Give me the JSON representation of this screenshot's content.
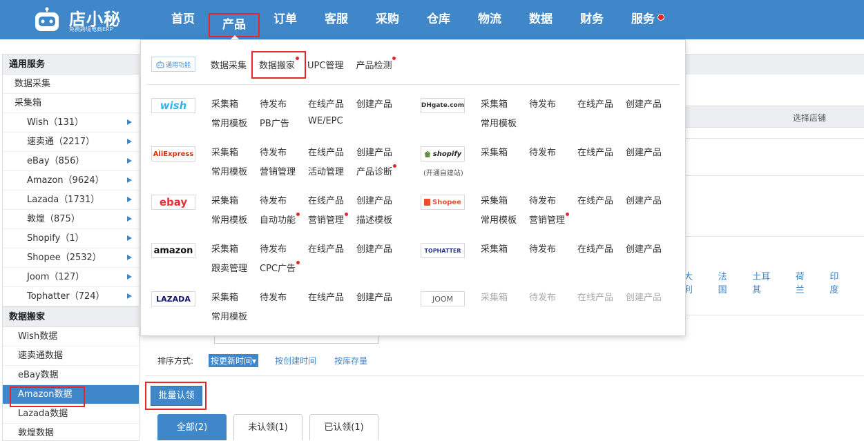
{
  "brand": {
    "title": "店小秘",
    "subtitle": "免费跨境电商ERP"
  },
  "topnav": [
    {
      "label": "首页",
      "active": false,
      "dot": false
    },
    {
      "label": "产品",
      "active": true,
      "dot": false
    },
    {
      "label": "订单",
      "active": false,
      "dot": false
    },
    {
      "label": "客服",
      "active": false,
      "dot": false
    },
    {
      "label": "采购",
      "active": false,
      "dot": false
    },
    {
      "label": "仓库",
      "active": false,
      "dot": false
    },
    {
      "label": "物流",
      "active": false,
      "dot": false
    },
    {
      "label": "数据",
      "active": false,
      "dot": false
    },
    {
      "label": "财务",
      "active": false,
      "dot": false
    },
    {
      "label": "服务",
      "active": false,
      "dot": true
    }
  ],
  "sidebar": {
    "section1": "通用服务",
    "data_collect": "数据采集",
    "collect_box": "采集箱",
    "platforms": [
      {
        "name": "Wish",
        "count": "（131）"
      },
      {
        "name": "速卖通",
        "count": "（2217）"
      },
      {
        "name": "eBay",
        "count": "（856）"
      },
      {
        "name": "Amazon",
        "count": "（9624）"
      },
      {
        "name": "Lazada",
        "count": "（1731）"
      },
      {
        "name": "敦煌",
        "count": "（875）"
      },
      {
        "name": "Shopify",
        "count": "（1）"
      },
      {
        "name": "Shopee",
        "count": "（2532）"
      },
      {
        "name": "Joom",
        "count": "（127）"
      },
      {
        "name": "Tophatter",
        "count": "（724）"
      }
    ],
    "section2": "数据搬家",
    "move_items": [
      "Wish数据",
      "速卖通数据",
      "eBay数据",
      "Amazon数据",
      "Lazada数据",
      "敦煌数据"
    ],
    "active_move_item": "Amazon数据"
  },
  "main": {
    "choose_shop": "选择店铺",
    "countries": [
      "大利",
      "法国",
      "土耳其",
      "荷兰",
      "印度"
    ],
    "sort_label": "排序方式:",
    "sort_active": "按更新时间▾",
    "sort_options": [
      "按创建时间",
      "按库存量"
    ],
    "bulk_claim": "批量认领",
    "tabs": [
      "全部(2)",
      "未认领(1)",
      "已认领(1)"
    ]
  },
  "mega": {
    "general_badge": "通用功能",
    "general_links": [
      "数据采集",
      "数据搬家",
      "UPC管理",
      "产品检测"
    ],
    "platforms": {
      "wish": {
        "logo": "wish",
        "links": [
          "采集箱",
          "待发布",
          "在线产品",
          "创建产品",
          "常用模板",
          "PB广告",
          "WE/EPC"
        ]
      },
      "dhgate": {
        "logo": "DHgate.com",
        "links": [
          "采集箱",
          "待发布",
          "在线产品",
          "创建产品",
          "常用模板"
        ]
      },
      "aliexpress": {
        "logo": "AliExpress",
        "links": [
          "采集箱",
          "待发布",
          "在线产品",
          "创建产品",
          "常用模板",
          "营销管理",
          "活动管理",
          "产品诊断"
        ]
      },
      "shopify": {
        "logo": "shopify",
        "note": "(开通自建站)",
        "links": [
          "采集箱",
          "待发布",
          "在线产品",
          "创建产品"
        ]
      },
      "ebay": {
        "logo": "ebay",
        "links": [
          "采集箱",
          "待发布",
          "在线产品",
          "创建产品",
          "常用模板",
          "自动功能",
          "营销管理",
          "描述模板"
        ]
      },
      "shopee": {
        "logo": "Shopee",
        "links": [
          "采集箱",
          "待发布",
          "在线产品",
          "创建产品",
          "常用模板",
          "营销管理"
        ]
      },
      "amazon": {
        "logo": "amazon",
        "links": [
          "采集箱",
          "待发布",
          "在线产品",
          "创建产品",
          "跟卖管理",
          "CPC广告"
        ]
      },
      "tophatter": {
        "logo": "TOPHATTER",
        "links": [
          "采集箱",
          "待发布",
          "在线产品",
          "创建产品"
        ]
      },
      "lazada": {
        "logo": "LAZADA",
        "links": [
          "采集箱",
          "待发布",
          "在线产品",
          "创建产品",
          "常用模板"
        ]
      },
      "joom": {
        "logo": "JOOM",
        "links": [
          "采集箱",
          "待发布",
          "在线产品",
          "创建产品"
        ]
      }
    }
  },
  "colors": {
    "primary": "#3f87c9",
    "highlight_red": "#e8262a",
    "panel_gray": "#eceef1"
  }
}
